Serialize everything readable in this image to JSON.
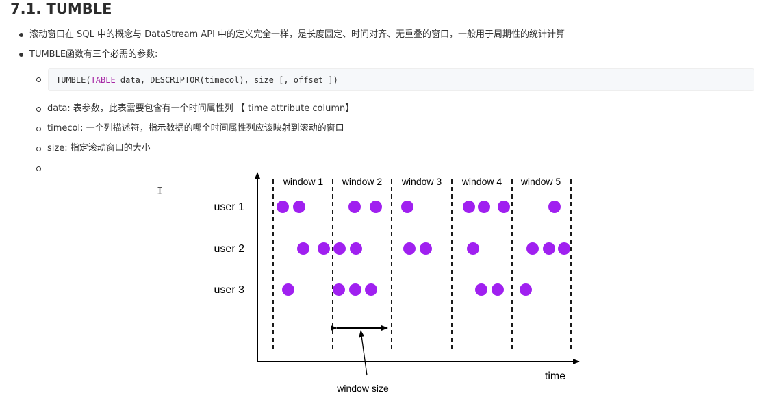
{
  "heading": "7.1. TUMBLE",
  "bullets": [
    "滚动窗口在 SQL 中的概念与 DataStream API 中的定义完全一样，是长度固定、时间对齐、无重叠的窗口，一般用于周期性的统计计算",
    "TUMBLE函数有三个必需的参数:"
  ],
  "code": {
    "prefix": "TUMBLE(",
    "keyword": "TABLE",
    "suffix": " data, DESCRIPTOR(timecol), size [, offset ])"
  },
  "params": [
    "data: 表参数，此表需要包含有一个时间属性列 【 time attribute column】",
    "timecol: 一个列描述符，指示数据的哪个时间属性列应该映射到滚动的窗口",
    "size: 指定滚动窗口的大小"
  ],
  "cursor_glyph": "I",
  "colors": {
    "event_dot": "#a020f0",
    "text": "#333333",
    "code_keyword": "#a626a4"
  },
  "diagram": {
    "windows": [
      "window 1",
      "window 2",
      "window 3",
      "window 4",
      "window 5"
    ],
    "users": [
      "user 1",
      "user 2",
      "user 3"
    ],
    "x_axis_label": "time",
    "size_label": "window size"
  }
}
